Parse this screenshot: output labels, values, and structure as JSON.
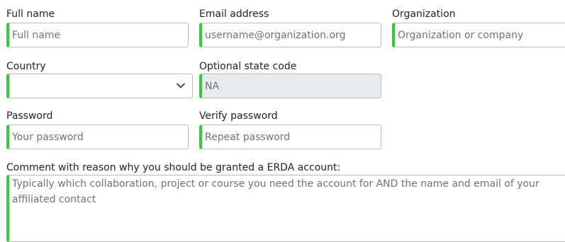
{
  "form": {
    "full_name": {
      "label": "Full name",
      "placeholder": "Full name",
      "value": ""
    },
    "email": {
      "label": "Email address",
      "placeholder": "username@organization.org",
      "value": ""
    },
    "organization": {
      "label": "Organization",
      "placeholder": "Organization or company",
      "value": ""
    },
    "country": {
      "label": "Country",
      "selected": ""
    },
    "state_code": {
      "label": "Optional state code",
      "value": "NA"
    },
    "password": {
      "label": "Password",
      "placeholder": "Your password"
    },
    "verify_password": {
      "label": "Verify password",
      "placeholder": "Repeat password"
    },
    "comment": {
      "label": "Comment with reason why you should be granted a ERDA account:",
      "placeholder": "Typically which collaboration, project or course you need the account for AND the name and email of your affiliated contact"
    }
  },
  "colors": {
    "valid_border": "#33cc33",
    "placeholder": "#6c757d",
    "readonly_background": "#e9ecef"
  },
  "icons": {
    "country_select": "chevron-down-icon"
  }
}
